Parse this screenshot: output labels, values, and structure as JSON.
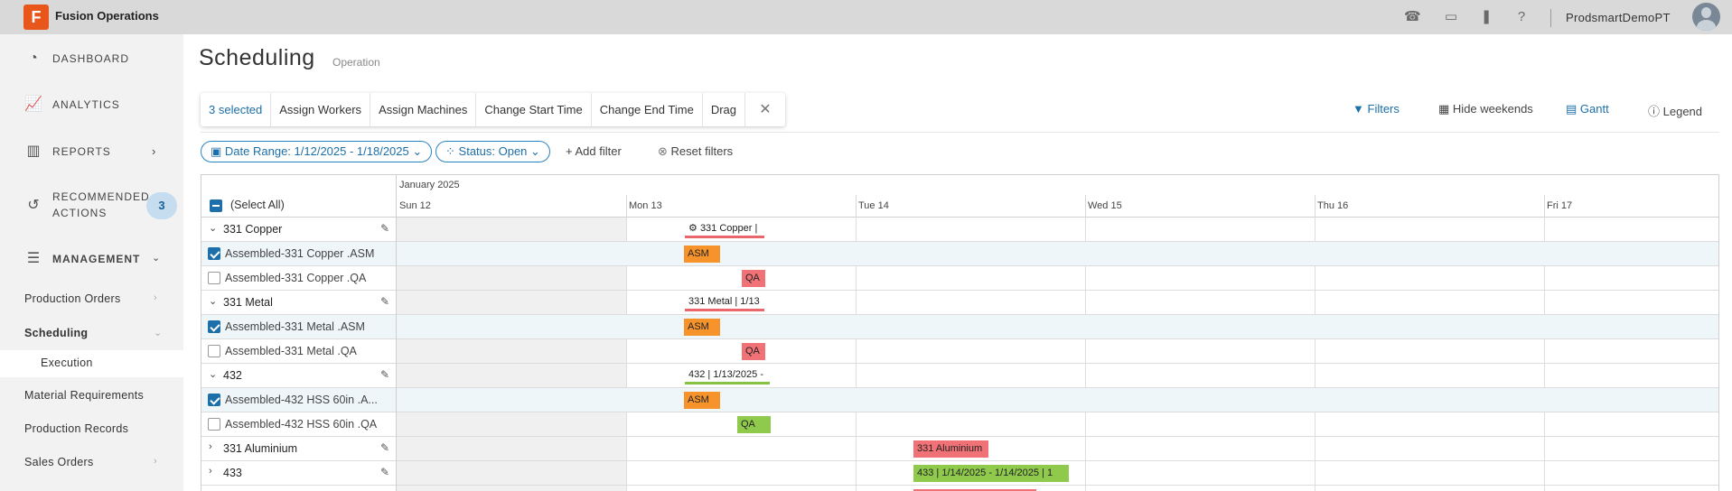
{
  "app": {
    "logo_letter": "F",
    "title": "Fusion Operations",
    "user": "ProdsmartDemoPT",
    "icons": [
      "phone-icon",
      "screen-icon",
      "bookmark-icon",
      "help-icon"
    ]
  },
  "sidebar": {
    "items": [
      {
        "label": "DASHBOARD",
        "icon": "dashboard-icon"
      },
      {
        "label": "ANALYTICS",
        "icon": "analytics-icon"
      },
      {
        "label": "REPORTS",
        "icon": "reports-icon"
      },
      {
        "label": "RECOMMENDED ACTIONS",
        "line1": "RECOMMENDED",
        "line2": "ACTIONS",
        "icon": "history-icon",
        "badge": "3"
      },
      {
        "label": "MANAGEMENT",
        "icon": "sliders-icon"
      }
    ],
    "sub_items": [
      {
        "label": "Production Orders"
      },
      {
        "label": "Scheduling"
      },
      {
        "label": "Execution"
      },
      {
        "label": "Material Requirements"
      },
      {
        "label": "Production Records"
      },
      {
        "label": "Sales Orders"
      }
    ]
  },
  "page": {
    "title": "Scheduling",
    "subtitle": "Operation"
  },
  "action_bar": {
    "selected": "3 selected",
    "assign_workers": "Assign Workers",
    "assign_machines": "Assign Machines",
    "change_start": "Change Start Time",
    "change_end": "Change End Time",
    "drag": "Drag",
    "close": "✕"
  },
  "tools": {
    "filters": "Filters",
    "hide_weekends": "Hide weekends",
    "gantt": "Gantt",
    "legend": "Legend"
  },
  "filters": {
    "date_range": "Date Range: 1/12/2025 - 1/18/2025",
    "status": "Status: Open",
    "add_filter": "+ Add filter",
    "reset_filters": "Reset filters"
  },
  "grid": {
    "select_all": "(Select All)",
    "month": "January 2025",
    "days": [
      "Sun 12",
      "Mon 13",
      "Tue 14",
      "Wed 15",
      "Thu 16",
      "Fri 17"
    ],
    "rows": [
      {
        "type": "group",
        "label": "331 Copper",
        "expanded": true
      },
      {
        "type": "child",
        "label": "Assembled-331 Copper .ASM",
        "checked": true
      },
      {
        "type": "child",
        "label": "Assembled-331 Copper .QA",
        "checked": false
      },
      {
        "type": "group",
        "label": "331 Metal",
        "expanded": true
      },
      {
        "type": "child",
        "label": "Assembled-331 Metal .ASM",
        "checked": true
      },
      {
        "type": "child",
        "label": "Assembled-331 Metal .QA",
        "checked": false
      },
      {
        "type": "group",
        "label": "432",
        "expanded": true
      },
      {
        "type": "child",
        "label": "Assembled-432 HSS 60in .A...",
        "checked": true
      },
      {
        "type": "child",
        "label": "Assembled-432 HSS 60in .QA",
        "checked": false
      },
      {
        "type": "group",
        "label": "331 Aluminium",
        "expanded": false
      },
      {
        "type": "group",
        "label": "433",
        "expanded": false
      }
    ],
    "bars": {
      "copper_group": "331 Copper |",
      "copper_asm": "ASM",
      "copper_qa": "QA",
      "metal_group": "331 Metal | 1/13",
      "metal_asm": "ASM",
      "metal_qa": "QA",
      "g432_group": "432 | 1/13/2025 -",
      "g432_asm": "ASM",
      "g432_qa": "QA",
      "alu_group": "331 Aluminium",
      "g433_group": "433 | 1/14/2025 - 1/14/2025 | 1"
    }
  },
  "colors": {
    "accent": "#1c6fa8",
    "asm": "#f7932b",
    "qa_red": "#f07176",
    "done_green": "#8fca4d",
    "logo": "#e8561b"
  }
}
